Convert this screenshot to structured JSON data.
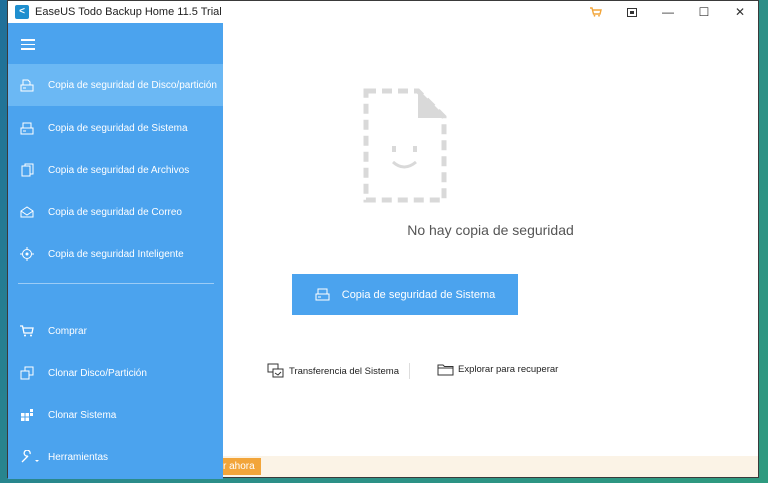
{
  "window": {
    "title": "EaseUS Todo Backup Home 11.5 Trial",
    "logo_char": "<"
  },
  "titlebar_controls": {
    "minimize": "—",
    "maximize": "☐",
    "close": "✕"
  },
  "sidebar": {
    "items": [
      {
        "label": "Copia de seguridad de Disco/partición",
        "icon": "disk-backup-icon",
        "active": true
      },
      {
        "label": "Copia de seguridad de Sistema",
        "icon": "system-backup-icon",
        "active": false
      },
      {
        "label": "Copia de seguridad de Archivos",
        "icon": "file-backup-icon",
        "active": false
      },
      {
        "label": "Copia de seguridad de Correo",
        "icon": "mail-backup-icon",
        "active": false
      },
      {
        "label": "Copia de seguridad Inteligente",
        "icon": "smart-backup-icon",
        "active": false
      }
    ],
    "tools": [
      {
        "label": "Comprar",
        "icon": "cart-icon"
      },
      {
        "label": "Clonar Disco/Partición",
        "icon": "clone-icon"
      },
      {
        "label": "Clonar Sistema",
        "icon": "clone-system-icon"
      },
      {
        "label": "Herramientas",
        "icon": "wrench-icon"
      }
    ]
  },
  "main": {
    "empty_message": "No hay copia de seguridad",
    "primary_button": "Copia de seguridad de Sistema",
    "links": {
      "transfer": "Transferencia del Sistema",
      "browse": "Explorar para recuperar"
    }
  },
  "footer": {
    "activate_label": "r ahora"
  },
  "colors": {
    "sidebar": "#4ba3ee",
    "sidebar_active": "#6bb8f4",
    "primary": "#4ba3ee",
    "accent_orange": "#f2a53a"
  }
}
